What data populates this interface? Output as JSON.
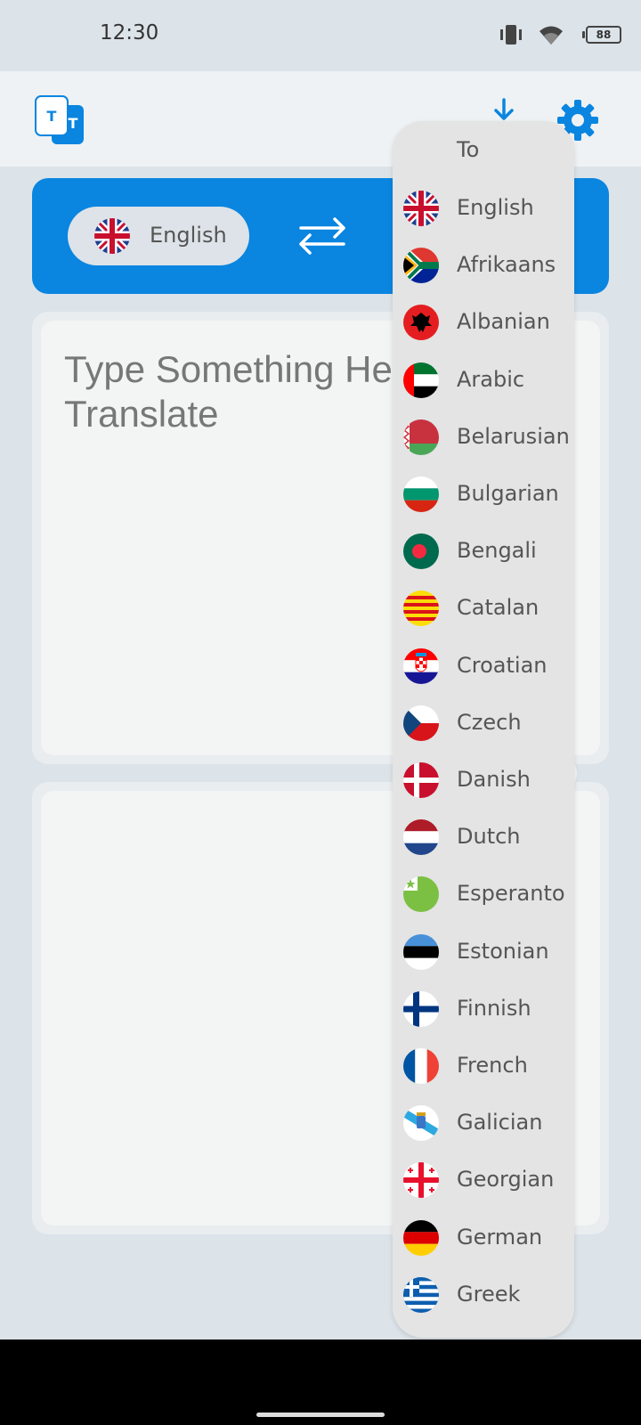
{
  "status_bar": {
    "time": "12:30",
    "battery": "88",
    "icons": [
      "vibrate-icon",
      "wifi-icon",
      "battery-icon"
    ]
  },
  "app_bar": {
    "logo_letters": "T T",
    "actions": [
      "download-icon",
      "settings-icon"
    ]
  },
  "colors": {
    "accent": "#0a85e0",
    "background": "#dce3e9",
    "card": "#f3f4f4",
    "dropdown": "#e4e4e4"
  },
  "language_bar": {
    "source_language": "English",
    "swap": "swap-icon"
  },
  "input": {
    "placeholder": "Type Something Here To Translate"
  },
  "dropdown": {
    "header": "To",
    "items": [
      {
        "label": "English",
        "flag": "uk"
      },
      {
        "label": "Afrikaans",
        "flag": "za"
      },
      {
        "label": "Albanian",
        "flag": "al"
      },
      {
        "label": "Arabic",
        "flag": "ae"
      },
      {
        "label": "Belarusian",
        "flag": "by"
      },
      {
        "label": "Bulgarian",
        "flag": "bg"
      },
      {
        "label": "Bengali",
        "flag": "bd"
      },
      {
        "label": "Catalan",
        "flag": "cat"
      },
      {
        "label": "Croatian",
        "flag": "hr"
      },
      {
        "label": "Czech",
        "flag": "cz"
      },
      {
        "label": "Danish",
        "flag": "dk"
      },
      {
        "label": "Dutch",
        "flag": "nl"
      },
      {
        "label": "Esperanto",
        "flag": "eo"
      },
      {
        "label": "Estonian",
        "flag": "ee"
      },
      {
        "label": "Finnish",
        "flag": "fi"
      },
      {
        "label": "French",
        "flag": "fr"
      },
      {
        "label": "Galician",
        "flag": "gal"
      },
      {
        "label": "Georgian",
        "flag": "ge"
      },
      {
        "label": "German",
        "flag": "de"
      },
      {
        "label": "Greek",
        "flag": "gr"
      }
    ]
  }
}
